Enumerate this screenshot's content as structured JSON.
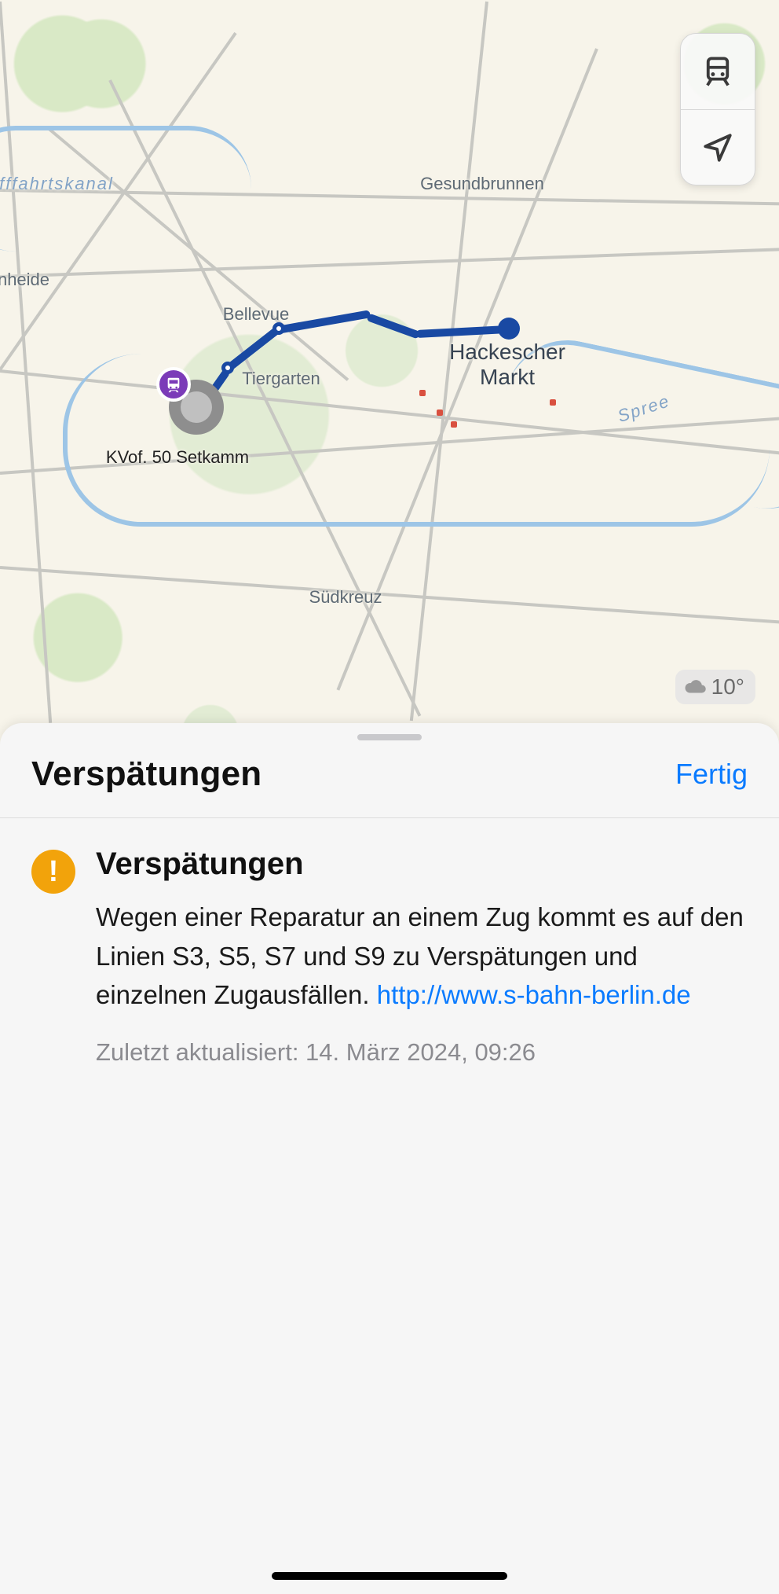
{
  "map": {
    "labels": {
      "gesundbrunnen": "Gesundbrunnen",
      "bellevue": "Bellevue",
      "tiergarten": "Tiergarten",
      "hackescher1": "Hackescher",
      "hackescher2": "Markt",
      "sudkreuz": "Südkreuz",
      "kanal": "fffahrtskanal",
      "spree": "Spree",
      "heide": "nheide"
    },
    "origin_caption": "KVof. 50 Setkamm",
    "weather_temp": "10°"
  },
  "sheet": {
    "title": "Verspätungen",
    "done": "Fertig",
    "alert_title": "Verspätungen",
    "alert_body": "Wegen einer Reparatur an einem Zug kommt es auf den Linien S3, S5, S7 und S9 zu Verspätungen und einzelnen Zugausfällen. ",
    "alert_link": "http://www.s-bahn-berlin.de",
    "updated": "Zuletzt aktualisiert: 14. März 2024, 09:26"
  }
}
